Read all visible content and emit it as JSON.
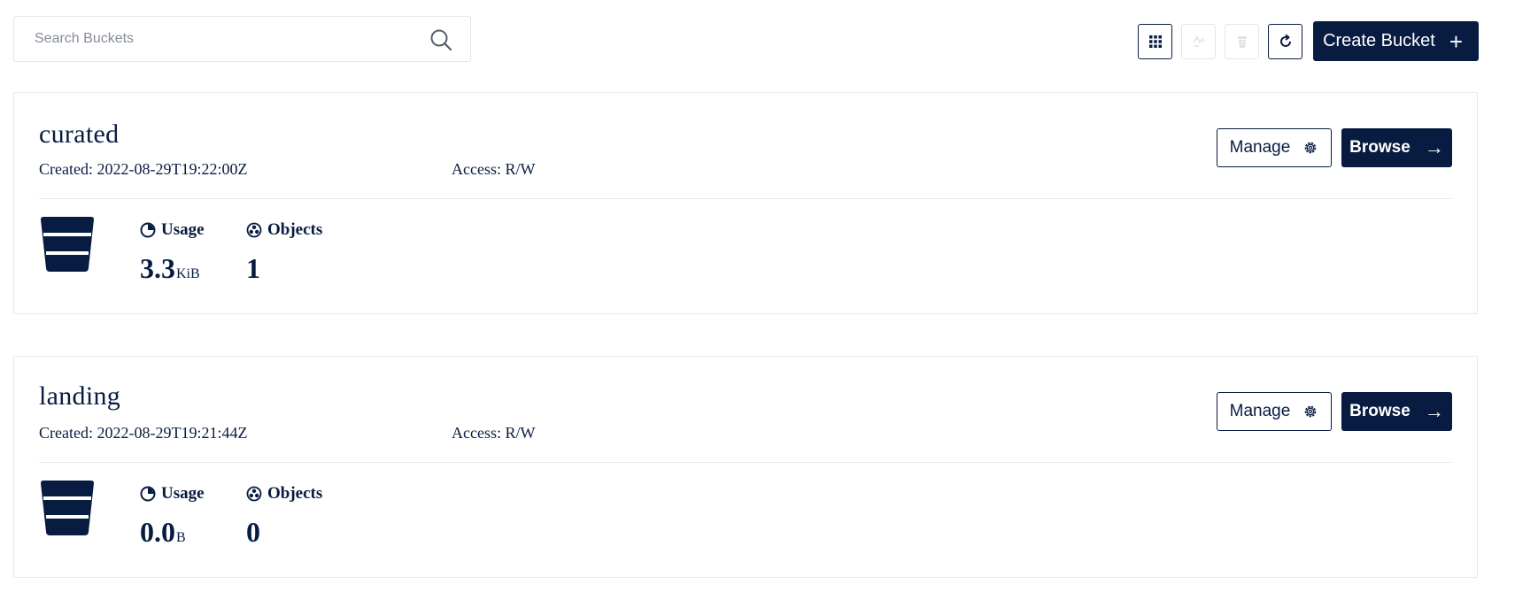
{
  "search": {
    "placeholder": "Search Buckets"
  },
  "toolbar": {
    "create_label": "Create Bucket",
    "icons": [
      "grid-view-icon",
      "replication-icon",
      "multi-delete-icon",
      "refresh-icon"
    ]
  },
  "buckets": [
    {
      "name": "curated",
      "created": "Created: 2022-08-29T19:22:00Z",
      "access": "Access: R/W",
      "usage_label": "Usage",
      "usage_value": "3.3",
      "usage_unit": "KiB",
      "objects_label": "Objects",
      "objects_value": "1",
      "manage_label": "Manage",
      "browse_label": "Browse"
    },
    {
      "name": "landing",
      "created": "Created: 2022-08-29T19:21:44Z",
      "access": "Access: R/W",
      "usage_label": "Usage",
      "usage_value": "0.0",
      "usage_unit": "B",
      "objects_label": "Objects",
      "objects_value": "0",
      "manage_label": "Manage",
      "browse_label": "Browse"
    }
  ],
  "colors": {
    "primary": "#081c42",
    "border": "#e6e8eb",
    "disabled": "#e3e5e9"
  }
}
